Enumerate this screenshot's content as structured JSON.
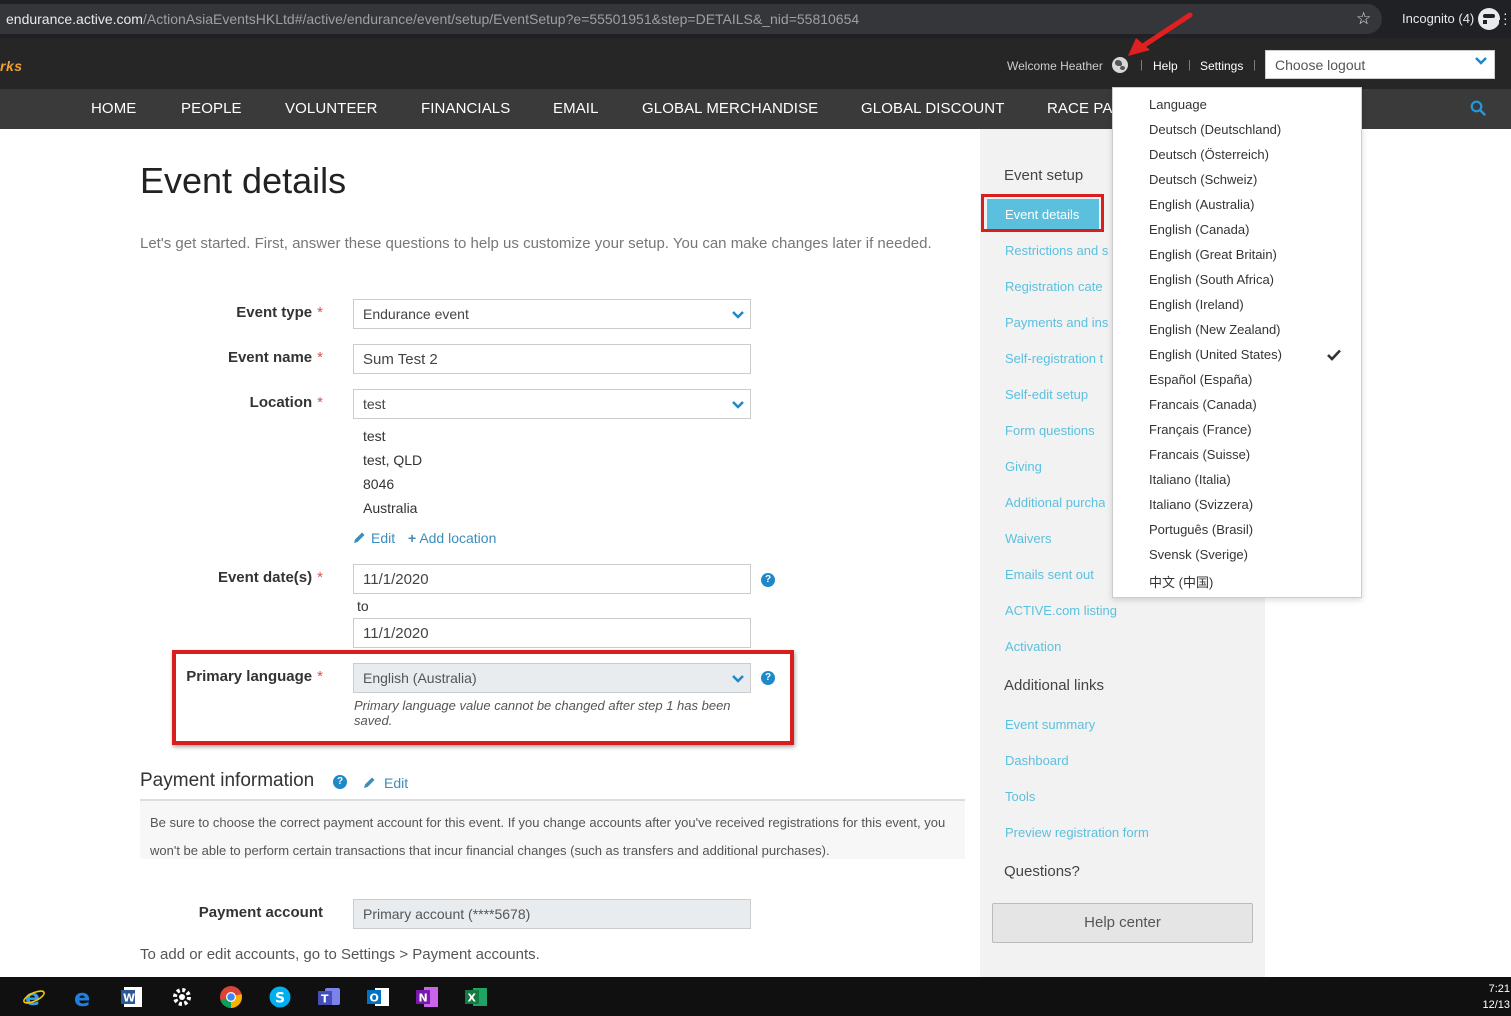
{
  "browser": {
    "url_host": "endurance.active.com",
    "url_path": "/ActionAsiaEventsHKLtd#/active/endurance/event/setup/EventSetup?e=55501951&step=DETAILS&_nid=55810654",
    "incognito_label": "Incognito (4)"
  },
  "header": {
    "logo_fragment": "rks",
    "welcome": "Welcome Heather",
    "help": "Help",
    "settings": "Settings",
    "logout_placeholder": "Choose logout"
  },
  "nav": {
    "items": [
      "HOME",
      "PEOPLE",
      "VOLUNTEER",
      "FINANCIALS",
      "EMAIL",
      "GLOBAL MERCHANDISE",
      "GLOBAL DISCOUNT",
      "RACE PA"
    ]
  },
  "main": {
    "title": "Event details",
    "intro": "Let's get started. First, answer these questions to help us customize your setup. You can make changes later if needed.",
    "event_type": {
      "label": "Event type",
      "value": "Endurance event"
    },
    "event_name": {
      "label": "Event name",
      "value": "Sum Test 2"
    },
    "location": {
      "label": "Location",
      "value": "test",
      "address": [
        "test",
        "test, QLD",
        "8046",
        "Australia"
      ],
      "edit": "Edit",
      "add": "Add location"
    },
    "event_dates": {
      "label": "Event date(s)",
      "start": "11/1/2020",
      "to": "to",
      "end": "11/1/2020"
    },
    "primary_language": {
      "label": "Primary language",
      "value": "English (Australia)",
      "note": "Primary language value cannot be changed after step 1 has been saved."
    },
    "payment": {
      "title": "Payment information",
      "edit": "Edit",
      "info": "Be sure to choose the correct payment account for this event. If you change accounts after you've received registrations for this event, you won't be able to perform certain transactions that incur financial changes (such as transfers and additional purchases).",
      "account_label": "Payment account",
      "account_value": "Primary account (****5678)",
      "footer": "To add or edit accounts, go to Settings > Payment accounts."
    },
    "required_mark": "*"
  },
  "sidebar": {
    "setup_heading": "Event setup",
    "active_item": "Event details",
    "setup_items": [
      "Restrictions and s",
      "Registration cate",
      "Payments and ins",
      "Self-registration t",
      "Self-edit setup",
      "Form questions",
      "Giving",
      "Additional purcha",
      "Waivers",
      "Emails sent out",
      "ACTIVE.com listing",
      "Activation"
    ],
    "links_heading": "Additional links",
    "link_items": [
      "Event summary",
      "Dashboard",
      "Tools",
      "Preview registration form"
    ],
    "questions_heading": "Questions?",
    "help_center": "Help center"
  },
  "language_menu": {
    "header": "Language",
    "items": [
      "Deutsch (Deutschland)",
      "Deutsch (Österreich)",
      "Deutsch (Schweiz)",
      "English (Australia)",
      "English (Canada)",
      "English (Great Britain)",
      "English (South Africa)",
      "English (Ireland)",
      "English (New Zealand)",
      "English (United States)",
      "Español (España)",
      "Francais (Canada)",
      "Français (France)",
      "Francais (Suisse)",
      "Italiano (Italia)",
      "Italiano (Svizzera)",
      "Português (Brasil)",
      "Svensk (Sverige)",
      "中文 (中国)"
    ],
    "selected": "English (United States)"
  },
  "taskbar": {
    "apps": [
      "internet-explorer",
      "edge",
      "word",
      "settings",
      "chrome",
      "skype",
      "teams",
      "outlook",
      "onenote",
      "excel"
    ],
    "time": "7:21",
    "date": "12/13"
  },
  "colors": {
    "accent": "#5bc0de",
    "link": "#3c8dbc",
    "highlight_red": "#d81e1e",
    "nav_bg": "#3a3a3a"
  }
}
